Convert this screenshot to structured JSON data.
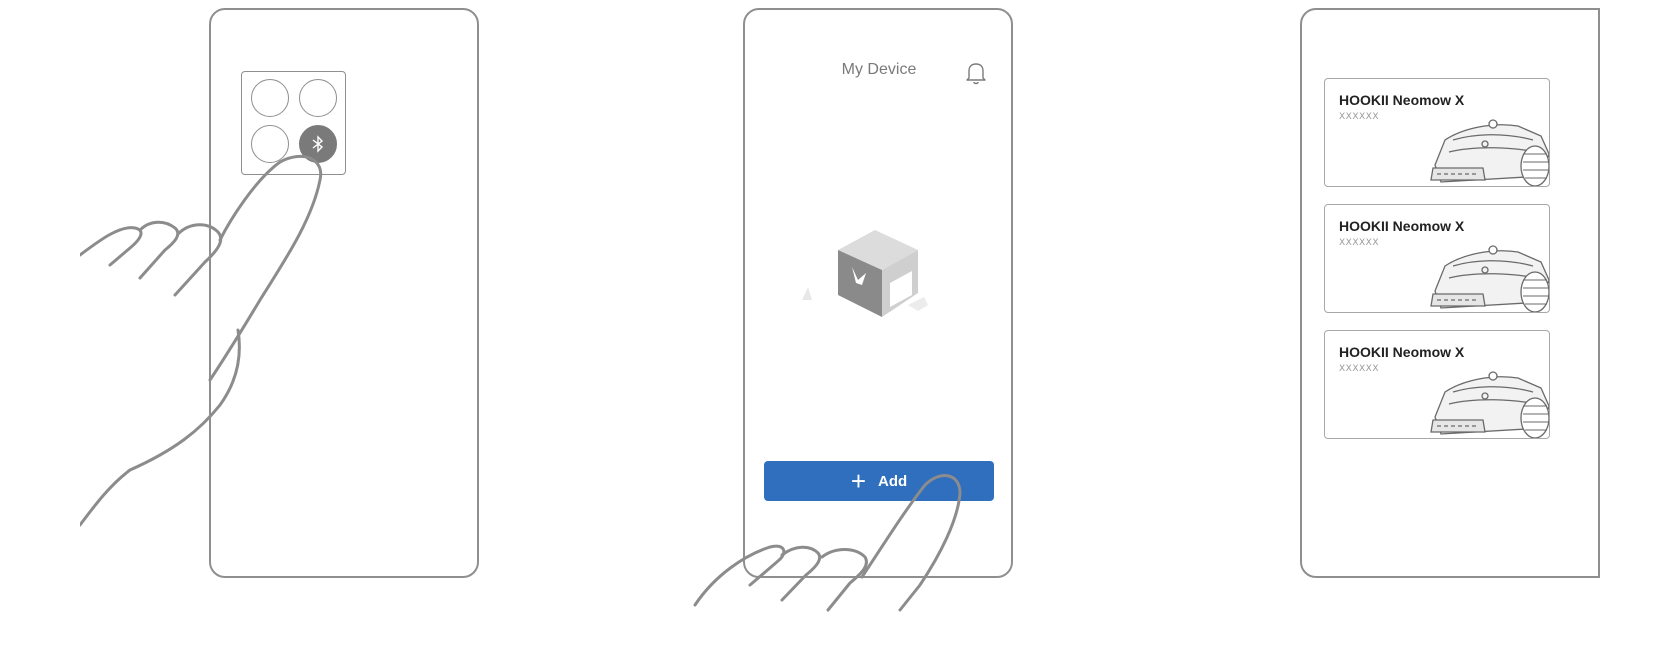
{
  "step1": {
    "bluetooth_icon": "bluetooth-icon"
  },
  "step2": {
    "title": "My Device",
    "bell_icon": "bell-icon",
    "add_button": {
      "icon": "plus-icon",
      "label": "Add"
    }
  },
  "step3": {
    "devices": [
      {
        "name": "HOOKII Neomow X",
        "subtitle": "XXXXXX"
      },
      {
        "name": "HOOKII Neomow X",
        "subtitle": "XXXXXX"
      },
      {
        "name": "HOOKII Neomow X",
        "subtitle": "XXXXXX"
      }
    ]
  },
  "colors": {
    "accent": "#2f6fbd",
    "outline": "#8f8f8f"
  }
}
